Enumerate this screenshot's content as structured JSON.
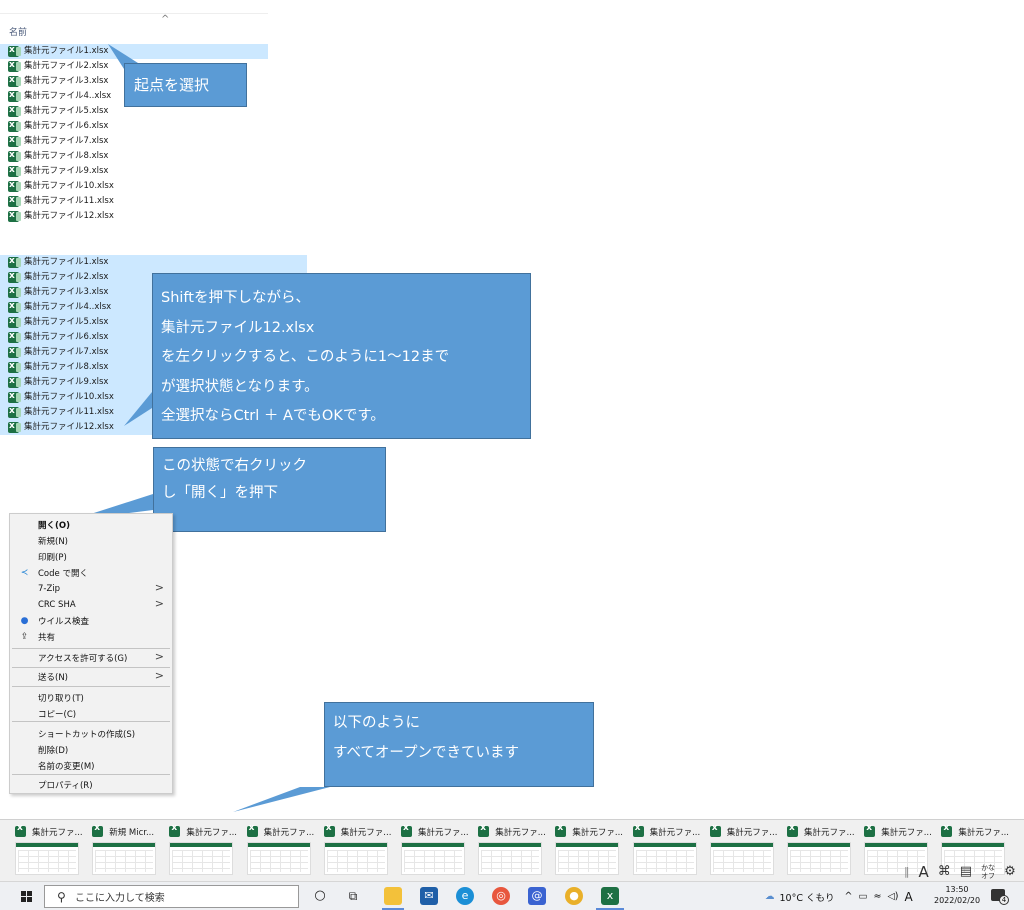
{
  "explorer_top": {
    "column_header": "名前",
    "sort_indicator": "^",
    "files": [
      "集計元ファイル1.xlsx",
      "集計元ファイル2.xlsx",
      "集計元ファイル3.xlsx",
      "集計元ファイル4..xlsx",
      "集計元ファイル5.xlsx",
      "集計元ファイル6.xlsx",
      "集計元ファイル7.xlsx",
      "集計元ファイル8.xlsx",
      "集計元ファイル9.xlsx",
      "集計元ファイル10.xlsx",
      "集計元ファイル11.xlsx",
      "集計元ファイル12.xlsx"
    ],
    "selected_index": 0
  },
  "explorer_bottom": {
    "files": [
      "集計元ファイル1.xlsx",
      "集計元ファイル2.xlsx",
      "集計元ファイル3.xlsx",
      "集計元ファイル4..xlsx",
      "集計元ファイル5.xlsx",
      "集計元ファイル6.xlsx",
      "集計元ファイル7.xlsx",
      "集計元ファイル8.xlsx",
      "集計元ファイル9.xlsx",
      "集計元ファイル10.xlsx",
      "集計元ファイル11.xlsx",
      "集計元ファイル12.xlsx"
    ]
  },
  "callouts": {
    "start_point": "起点を選択",
    "shift_select": [
      "Shiftを押下しながら、",
      "集計元ファイル12.xlsx",
      "を左クリックすると、このように1～12まで",
      "が選択状態となります。",
      "全選択ならCtrl ＋ AでもOKです。"
    ],
    "right_click": [
      "この状態で右クリック",
      "し「開く」を押下"
    ],
    "all_open": [
      "以下のように",
      "すべてオープンできています"
    ]
  },
  "context_menu": {
    "items": [
      {
        "label": "開く(O)",
        "bold": true
      },
      {
        "label": "新規(N)"
      },
      {
        "label": "印刷(P)"
      },
      {
        "label": "Code で開く",
        "icon": "vscode-icon"
      },
      {
        "label": "7-Zip",
        "submenu": true
      },
      {
        "label": "CRC SHA",
        "submenu": true
      },
      {
        "label": "ウイルス検査",
        "icon": "shield-icon"
      },
      {
        "label": "共有",
        "icon": "share-icon"
      },
      {
        "label": "アクセスを許可する(G)",
        "submenu": true
      },
      {
        "label": "送る(N)",
        "submenu": true
      },
      {
        "label": "切り取り(T)"
      },
      {
        "label": "コピー(C)"
      },
      {
        "label": "ショートカットの作成(S)"
      },
      {
        "label": "削除(D)"
      },
      {
        "label": "名前の変更(M)"
      },
      {
        "label": "プロパティ(R)"
      }
    ],
    "submenu_arrow": ">"
  },
  "taskbar_thumbnails": [
    "集計元ファ...",
    "新規 Micr...",
    "集計元ファ...",
    "集計元ファ...",
    "集計元ファ...",
    "集計元ファ...",
    "集計元ファ...",
    "集計元ファ...",
    "集計元ファ...",
    "集計元ファ...",
    "集計元ファ...",
    "集計元ファ...",
    "集計元ファ..."
  ],
  "ime_toolbar": {
    "letter": "A",
    "kana_top": "かな",
    "kana_bottom": "オフ"
  },
  "taskbar": {
    "search_placeholder": "ここに入力して検索",
    "weather": "10°C くもり",
    "ime_mode": "A",
    "time": "13:50",
    "date": "2022/02/20",
    "notification_count": "4",
    "colors": {
      "excel": "#1d7044",
      "selection": "#cce8ff",
      "callout": "#5b9bd5",
      "callout_border": "#41719c"
    }
  }
}
